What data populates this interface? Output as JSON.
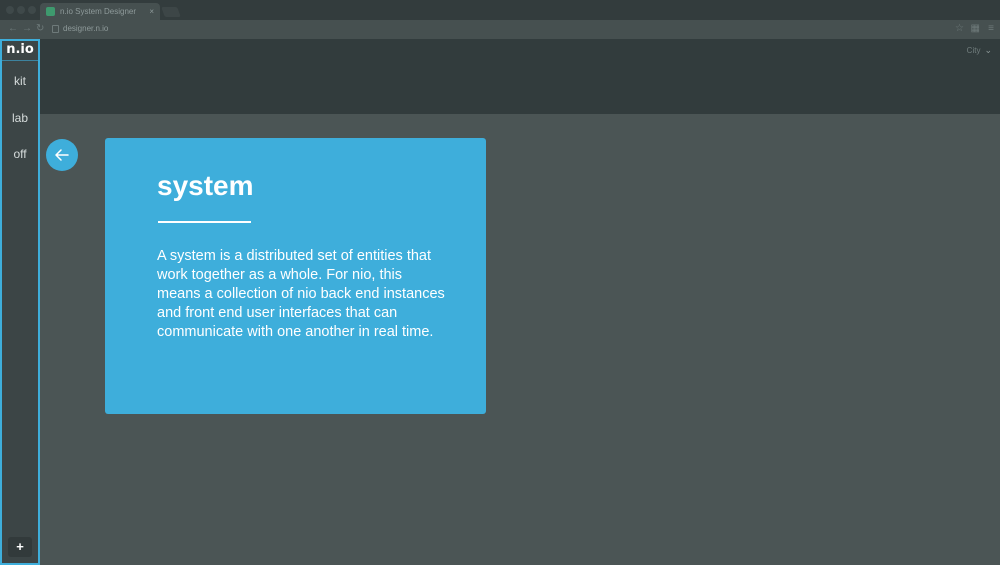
{
  "browser": {
    "tab_title": "n.io System Designer",
    "tab_close": "×",
    "url": "designer.n.io"
  },
  "sidebar": {
    "brand": "n.io",
    "items": [
      {
        "label": "kit"
      },
      {
        "label": "lab"
      },
      {
        "label": "off"
      }
    ],
    "add_label": "+"
  },
  "header": {
    "user_label": "City"
  },
  "card": {
    "title": "system",
    "body": "A system is a distributed set of entities that work together as a whole. For nio, this means a collection of nio back end instances and front end user interfaces that can communicate with one another in real time."
  },
  "colors": {
    "accent": "#3eaedb",
    "background": "#4b5555",
    "header": "#323c3d",
    "sidebar": "#3c4546"
  }
}
